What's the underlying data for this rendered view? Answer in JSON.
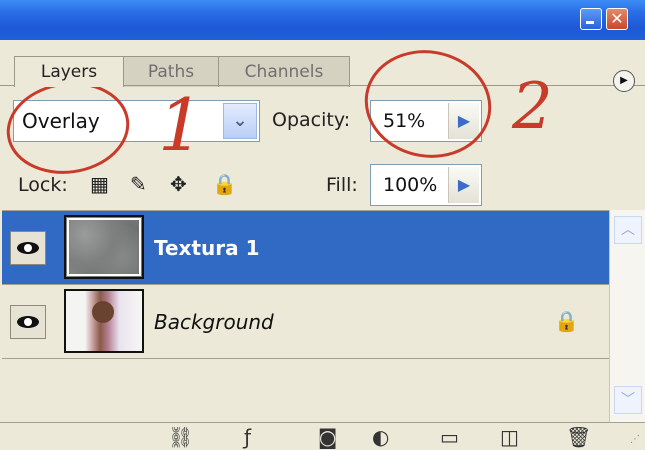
{
  "tabs": [
    {
      "label": "Layers"
    },
    {
      "label": "Paths"
    },
    {
      "label": "Channels"
    }
  ],
  "blend_mode": {
    "value": "Overlay"
  },
  "opacity": {
    "label": "Opacity:",
    "value": "51%"
  },
  "lock": {
    "label": "Lock:"
  },
  "fill": {
    "label": "Fill:",
    "value": "100%"
  },
  "layers": [
    {
      "name": "Textura 1",
      "selected": true
    },
    {
      "name": "Background",
      "locked": true
    }
  ],
  "annotations": {
    "one": "1",
    "two": "2",
    "color": "#c83a2a"
  },
  "colors": {
    "selection": "#316ac5",
    "panel": "#ece9d8",
    "titlebar": "#2a6fe6"
  },
  "icons": [
    "minimize-icon",
    "close-icon",
    "panel-menu-icon",
    "chevron-down-icon",
    "arrow-right-icon",
    "lock-transparent-icon",
    "brush-icon",
    "move-icon",
    "lock-all-icon",
    "eye-icon",
    "lock-icon",
    "link-icon",
    "layer-style-icon",
    "layer-mask-icon",
    "adjustment-layer-icon",
    "folder-icon",
    "new-layer-icon",
    "trash-icon"
  ]
}
